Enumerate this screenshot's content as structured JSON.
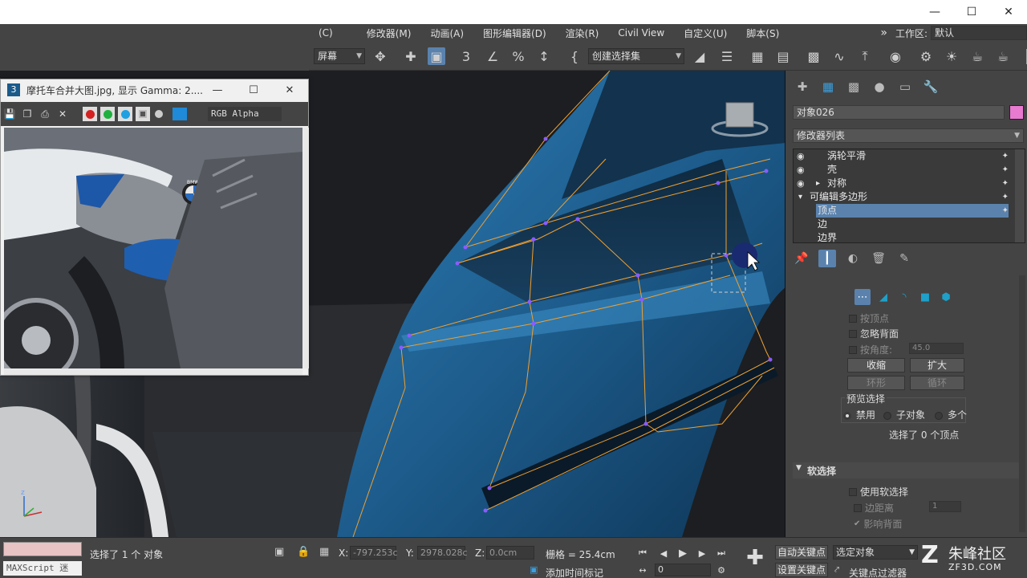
{
  "image_window": {
    "title": "摩托车合并大图.jpg, 显示 Gamma: 2....",
    "channel": "RGB Alpha",
    "brand_text": "BMW",
    "icon_letter": "3"
  },
  "menu": {
    "items": [
      "(C)",
      "修改器(M)",
      "动画(A)",
      "图形编辑器(D)",
      "渲染(R)",
      "Civil View",
      "自定义(U)",
      "脚本(S)"
    ],
    "more": "»",
    "workspace_label": "工作区:",
    "workspace_value": "默认"
  },
  "toolbar": {
    "ref_coord": "屏幕",
    "selection_set": "创建选择集"
  },
  "panel": {
    "object_name": "对象026",
    "modifier_list": "修改器列表",
    "stack": [
      {
        "label": "涡轮平滑",
        "eye": true,
        "expand": ""
      },
      {
        "label": "壳",
        "eye": true,
        "expand": ""
      },
      {
        "label": "对称",
        "eye": true,
        "expand": "▸"
      },
      {
        "label": "可编辑多边形",
        "eye": false,
        "expand": "▾"
      },
      {
        "label": "顶点",
        "eye": false,
        "expand": "",
        "selected": true
      },
      {
        "label": "边",
        "eye": false,
        "expand": ""
      },
      {
        "label": "边界",
        "eye": false,
        "expand": ""
      }
    ],
    "selection": {
      "by_vertex": "按顶点",
      "ignore_backface": "忽略背面",
      "by_angle": "按角度:",
      "angle_value": "45.0",
      "shrink": "收缩",
      "grow": "扩大",
      "ring": "环形",
      "loop": "循环",
      "preview_label": "预览选择",
      "preview_options": [
        "禁用",
        "子对象",
        "多个"
      ],
      "status": "选择了 0 个顶点"
    },
    "soft_selection": {
      "title": "软选择",
      "use_soft": "使用软选择",
      "edge_distance": "边距离",
      "edge_value": "1",
      "affect_backface": "影响背面"
    }
  },
  "status": {
    "maxscript": "MAXScript 迷",
    "selected_text": "选择了 1 个 对象",
    "x_label": "X:",
    "x_value": "-797.253c",
    "y_label": "Y:",
    "y_value": "2978.028c",
    "z_label": "Z:",
    "z_value": "0.0cm",
    "grid": "栅格 = 25.4cm",
    "add_time_tag": "添加时间标记",
    "frame": "0",
    "auto_key": "自动关键点",
    "set_key": "设置关键点",
    "selected_object": "选定对象",
    "key_filter": "关键点过滤器",
    "watermark": "朱峰社区",
    "watermark_sub": "ZF3D.COM"
  }
}
